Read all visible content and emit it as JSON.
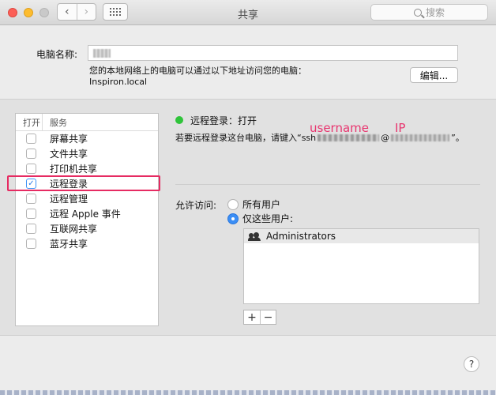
{
  "window": {
    "title": "共享",
    "back_glyph": "‹",
    "forward_glyph": "›",
    "search_placeholder": "搜索"
  },
  "computer_name": {
    "label": "电脑名称:",
    "description_line1": "您的本地网络上的电脑可以通过以下地址访问您的电脑：",
    "description_line2": "Inspiron.local",
    "edit_button": "编辑..."
  },
  "services": {
    "col_open": "打开",
    "col_service": "服务",
    "items": [
      {
        "label": "屏幕共享",
        "checked": false
      },
      {
        "label": "文件共享",
        "checked": false
      },
      {
        "label": "打印机共享",
        "checked": false
      },
      {
        "label": "远程登录",
        "checked": true
      },
      {
        "label": "远程管理",
        "checked": false
      },
      {
        "label": "远程 Apple 事件",
        "checked": false
      },
      {
        "label": "互联网共享",
        "checked": false
      },
      {
        "label": "蓝牙共享",
        "checked": false
      }
    ],
    "check_glyph": "✓"
  },
  "detail": {
    "status": "远程登录：打开",
    "status_color": "#2fc43a",
    "ssh_prefix": "若要远程登录这台电脑，请键入“ssh",
    "ssh_at": "@",
    "ssh_suffix": "”。",
    "annotation_username": "username",
    "annotation_ip": "IP",
    "annotation_color": "#e8356f",
    "access_label": "允许访问:",
    "radio_all": "所有用户",
    "radio_only": "仅这些用户:",
    "selected_radio": "only",
    "users": [
      "Administrators"
    ],
    "add_glyph": "+",
    "remove_glyph": "−"
  },
  "help_glyph": "?",
  "accent_color": "#3b8ef5",
  "highlight_color": "#e62b62"
}
